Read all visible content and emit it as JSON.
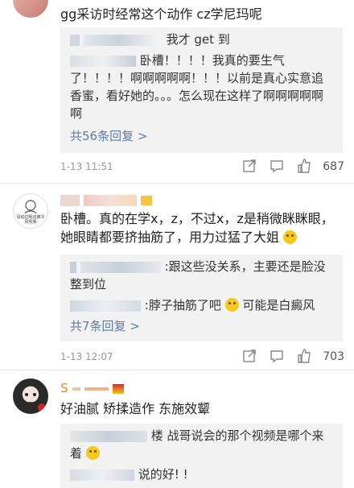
{
  "comment1": {
    "text": "gg采访时经常这个动作 cz学尼玛呢",
    "reply1_tail": "我才 get 到",
    "reply2": "卧槽！！！！我真的要生气了！！！！啊啊啊啊啊！！！以前是真心实意追香蜜，看好她的。。。怎么现在这样了啊啊啊啊啊啊",
    "more": "共56条回复 >",
    "time": "1-13 11:51",
    "likes": "687"
  },
  "comment2": {
    "avatar_text": "没动过呢还被冷风吹我",
    "text": "卧槽。真的在学x，z，不过x，z是稍微眯眯眼，她眼睛都要挤抽筋了，用力过猛了大姐",
    "reply1": ":跟这些没关系，主要还是脸没整到位",
    "reply2": ":脖子抽筋了吧",
    "reply2_tail": "可能是白癜风",
    "more": "共7条回复 >",
    "time": "1-13 12:07",
    "likes": "703"
  },
  "comment3": {
    "name_initial": "S",
    "text": "好油腻 矫揉造作 东施效颦",
    "reply1": "楼 战哥说会的那个视频是哪个来着",
    "reply2": "说的好! !"
  },
  "colors": {
    "link": "#5b7ea6",
    "reply_bg": "#f2f2f2",
    "meta": "#999999"
  },
  "icons": [
    "share-icon",
    "comment-icon",
    "like-icon"
  ]
}
